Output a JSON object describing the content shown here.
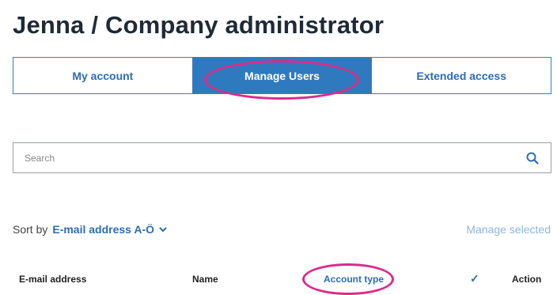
{
  "page_title": "Jenna  / Company administrator",
  "tabs": [
    {
      "label": "My account",
      "active": false
    },
    {
      "label": "Manage Users",
      "active": true
    },
    {
      "label": "Extended access",
      "active": false
    }
  ],
  "search": {
    "placeholder": "Search",
    "value": "",
    "icon": "search-icon"
  },
  "sort": {
    "label": "Sort by",
    "value": "E-mail address A-Ö",
    "icon": "chevron-down-icon"
  },
  "manage_selected": "Manage selected",
  "table": {
    "columns": [
      "E-mail address",
      "Name",
      "Account type",
      "✓",
      "Action"
    ]
  },
  "colors": {
    "accent": "#2f7abf",
    "link": "#2d6cb5",
    "disabled_link": "#8fb4da",
    "annotation": "#e0288a"
  }
}
